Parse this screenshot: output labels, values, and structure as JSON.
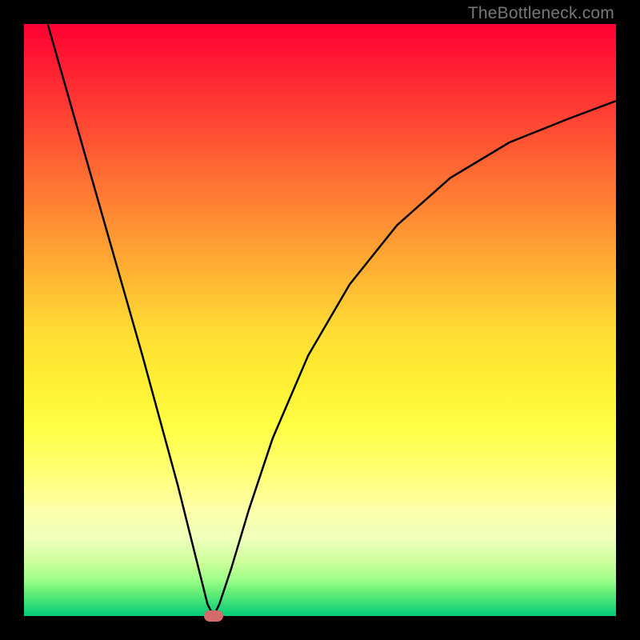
{
  "watermark": "TheBottleneck.com",
  "chart_data": {
    "type": "line",
    "title": "",
    "xlabel": "",
    "ylabel": "",
    "xlim": [
      0,
      100
    ],
    "ylim": [
      0,
      100
    ],
    "grid": false,
    "series": [
      {
        "name": "bottleneck-curve",
        "x": [
          4,
          8,
          12,
          16,
          20,
          23,
          26,
          28,
          30,
          31,
          32,
          33,
          35,
          38,
          42,
          48,
          55,
          63,
          72,
          82,
          92,
          100
        ],
        "y": [
          100,
          86,
          72,
          58,
          44,
          33,
          22,
          14,
          6,
          2,
          0,
          2,
          8,
          18,
          30,
          44,
          56,
          66,
          74,
          80,
          84,
          87
        ]
      }
    ],
    "marker": {
      "x": 32,
      "y": 0,
      "color": "#d46a6a"
    },
    "background_gradient": [
      {
        "stop": 0.0,
        "color": "#ff0033"
      },
      {
        "stop": 0.5,
        "color": "#ffdd33"
      },
      {
        "stop": 0.85,
        "color": "#ffffaa"
      },
      {
        "stop": 1.0,
        "color": "#00cc77"
      }
    ]
  }
}
